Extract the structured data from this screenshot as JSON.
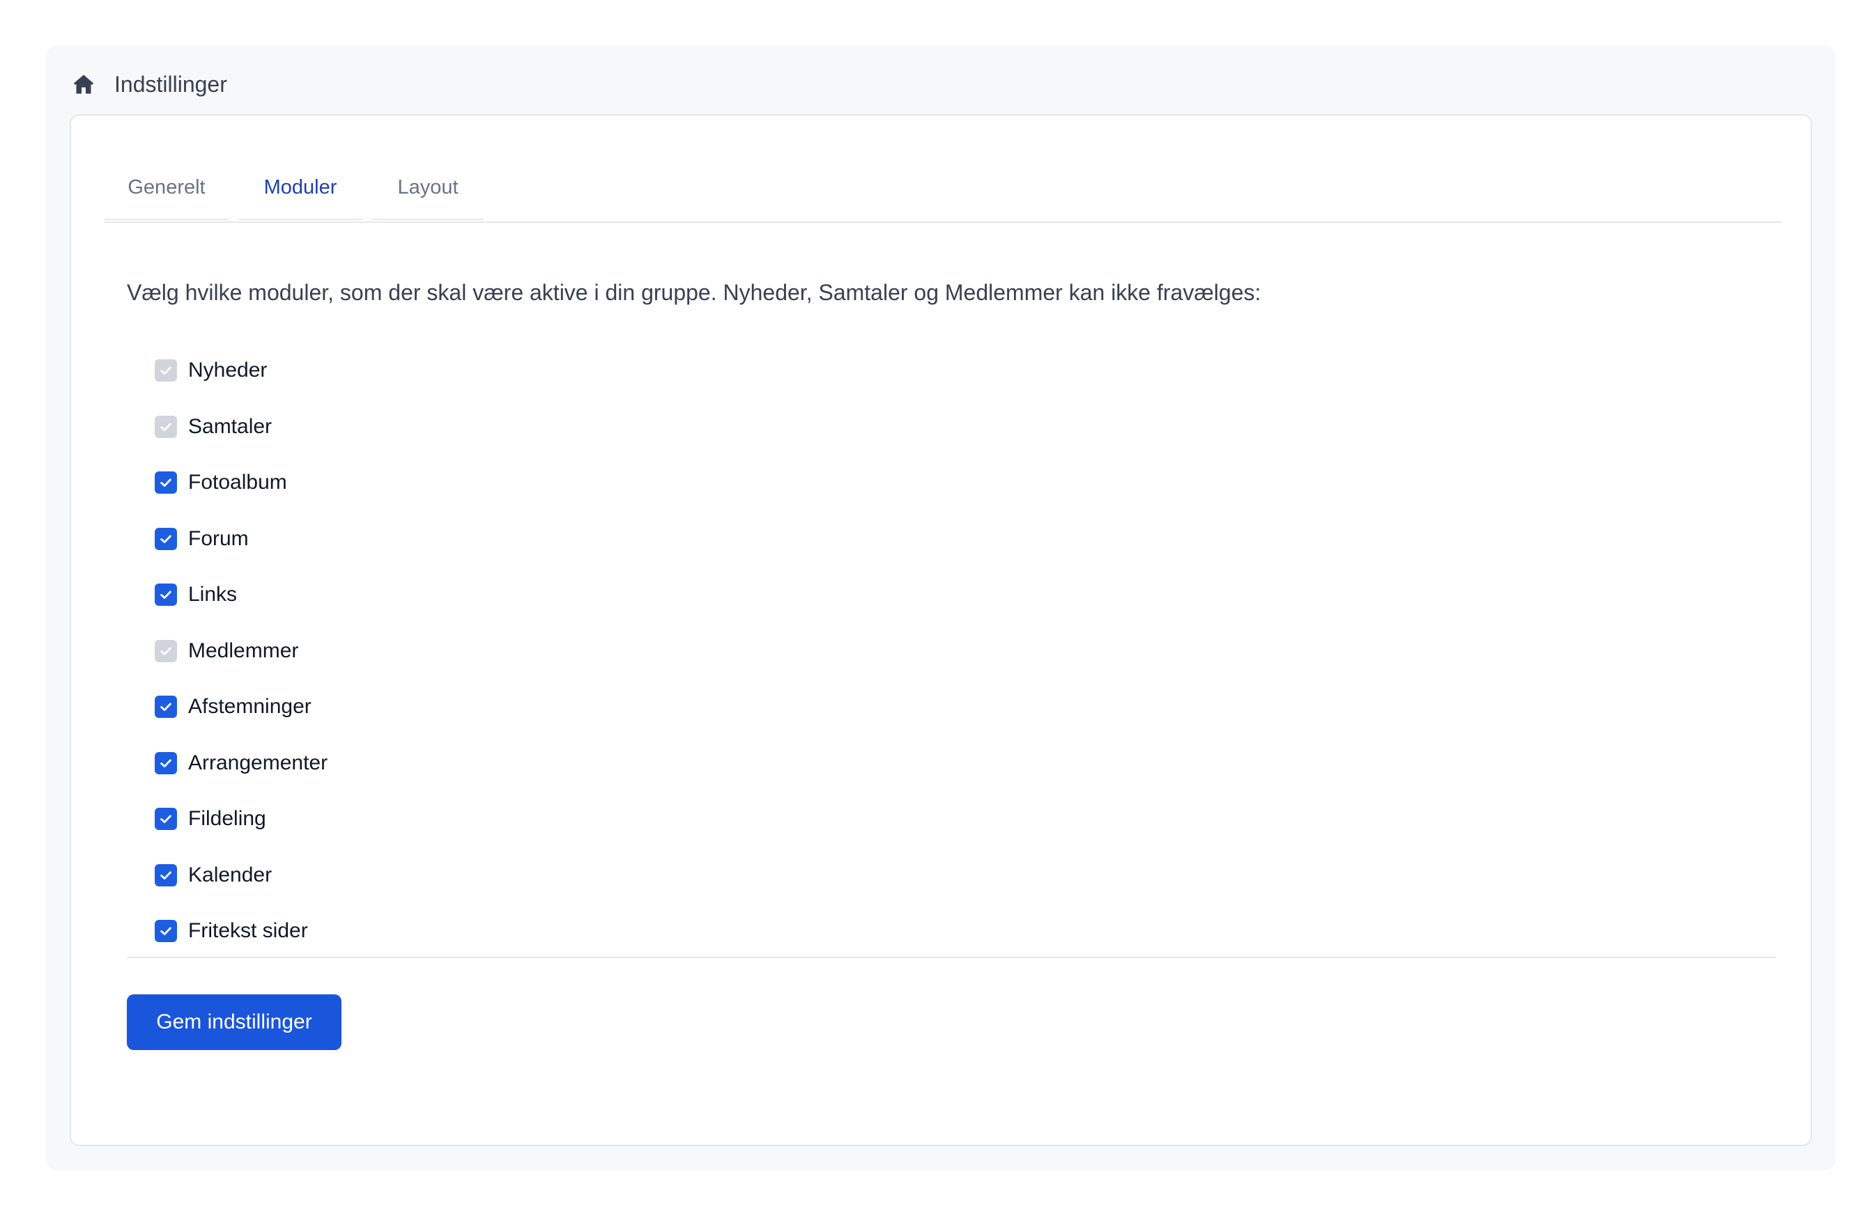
{
  "header": {
    "title": "Indstillinger",
    "icon": "home-icon"
  },
  "tabs": [
    {
      "label": "Generelt",
      "active": false
    },
    {
      "label": "Moduler",
      "active": true
    },
    {
      "label": "Layout",
      "active": false
    }
  ],
  "intro_text": "Vælg hvilke moduler, som der skal være aktive i din gruppe. Nyheder, Samtaler og Medlemmer kan ikke fravælges:",
  "modules": [
    {
      "label": "Nyheder",
      "checked": true,
      "disabled": true
    },
    {
      "label": "Samtaler",
      "checked": true,
      "disabled": true
    },
    {
      "label": "Fotoalbum",
      "checked": true,
      "disabled": false
    },
    {
      "label": "Forum",
      "checked": true,
      "disabled": false
    },
    {
      "label": "Links",
      "checked": true,
      "disabled": false
    },
    {
      "label": "Medlemmer",
      "checked": true,
      "disabled": true
    },
    {
      "label": "Afstemninger",
      "checked": true,
      "disabled": false
    },
    {
      "label": "Arrangementer",
      "checked": true,
      "disabled": false
    },
    {
      "label": "Fildeling",
      "checked": true,
      "disabled": false
    },
    {
      "label": "Kalender",
      "checked": true,
      "disabled": false
    },
    {
      "label": "Fritekst sider",
      "checked": true,
      "disabled": false
    }
  ],
  "save_button": {
    "label": "Gem indstillinger"
  },
  "colors": {
    "accent": "#1a56db",
    "checkbox_on": "#1d5ee0",
    "checkbox_disabled": "#d1d5db",
    "active_tab": "#1e40af"
  }
}
